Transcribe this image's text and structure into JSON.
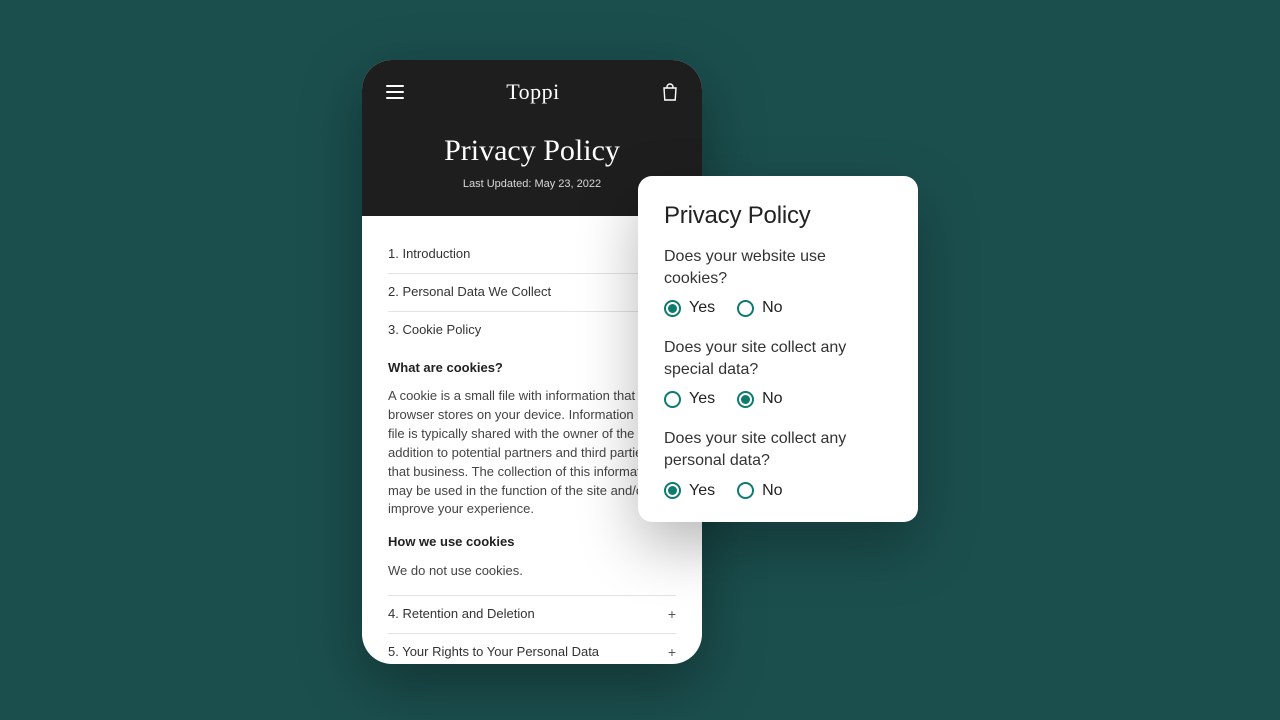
{
  "phone": {
    "brand": "Toppi",
    "title": "Privacy Policy",
    "last_updated": "Last Updated: May 23, 2022",
    "toc": {
      "item1": "1. Introduction",
      "item2": "2. Personal Data We Collect",
      "item3": "3. Cookie Policy",
      "item4": "4. Retention and Deletion",
      "item5": "5. Your Rights to Your Personal Data"
    },
    "cookie_section": {
      "heading1": "What are cookies?",
      "para1": "A cookie is a small file with information that your browser stores on your device. Information in this file is typically shared with the owner of the site in addition to potential partners and third parties to that business. The collection of this information may be used in the function of the site and/or to improve your experience.",
      "heading2": "How we use cookies",
      "para2": "We do not use cookies."
    }
  },
  "card": {
    "title": "Privacy Policy",
    "q1": {
      "text": "Does your website use cookies?",
      "yes": "Yes",
      "no": "No",
      "selected": "yes"
    },
    "q2": {
      "text": "Does your site collect any special data?",
      "yes": "Yes",
      "no": "No",
      "selected": "no"
    },
    "q3": {
      "text": "Does your site collect any personal data?",
      "yes": "Yes",
      "no": "No",
      "selected": "yes"
    }
  },
  "colors": {
    "background": "#1b4f4e",
    "phone_header": "#1e1e1e",
    "accent": "#0f7a6e"
  }
}
